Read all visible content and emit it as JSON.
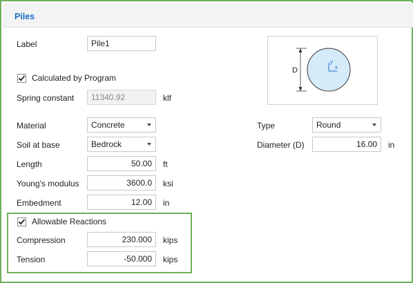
{
  "section": {
    "title": "Piles"
  },
  "fields": {
    "label": {
      "label": "Label",
      "value": "Pile1"
    },
    "calculated": {
      "label": "Calculated by Program",
      "checked": true
    },
    "spring": {
      "label": "Spring constant",
      "value": "11340.92",
      "unit": "klf"
    },
    "material": {
      "label": "Material",
      "value": "Concrete"
    },
    "soil": {
      "label": "Soil at base",
      "value": "Bedrock"
    },
    "length": {
      "label": "Length",
      "value": "50.00",
      "unit": "ft"
    },
    "modulus": {
      "label": "Young's modulus",
      "value": "3600.0",
      "unit": "ksi"
    },
    "embedment": {
      "label": "Embedment",
      "value": "12.00",
      "unit": "in"
    },
    "type": {
      "label": "Type",
      "value": "Round"
    },
    "diameter": {
      "label": "Diameter (D)",
      "value": "16.00",
      "unit": "in"
    }
  },
  "reactions": {
    "toggle": {
      "label": "Allowable Reactions",
      "checked": true
    },
    "compression": {
      "label": "Compression",
      "value": "230.000",
      "unit": "kips"
    },
    "tension": {
      "label": "Tension",
      "value": "-50.000",
      "unit": "kips"
    }
  },
  "diagram": {
    "dim_label": "D",
    "axis_y": "y",
    "axis_x": "x"
  },
  "colors": {
    "accent": "#1a6fc4",
    "highlight_border": "#6db05a",
    "circle_fill": "#d6ebfa"
  },
  "icons": {
    "checkbox": "check-icon",
    "dropdown": "chevron-down-icon"
  }
}
